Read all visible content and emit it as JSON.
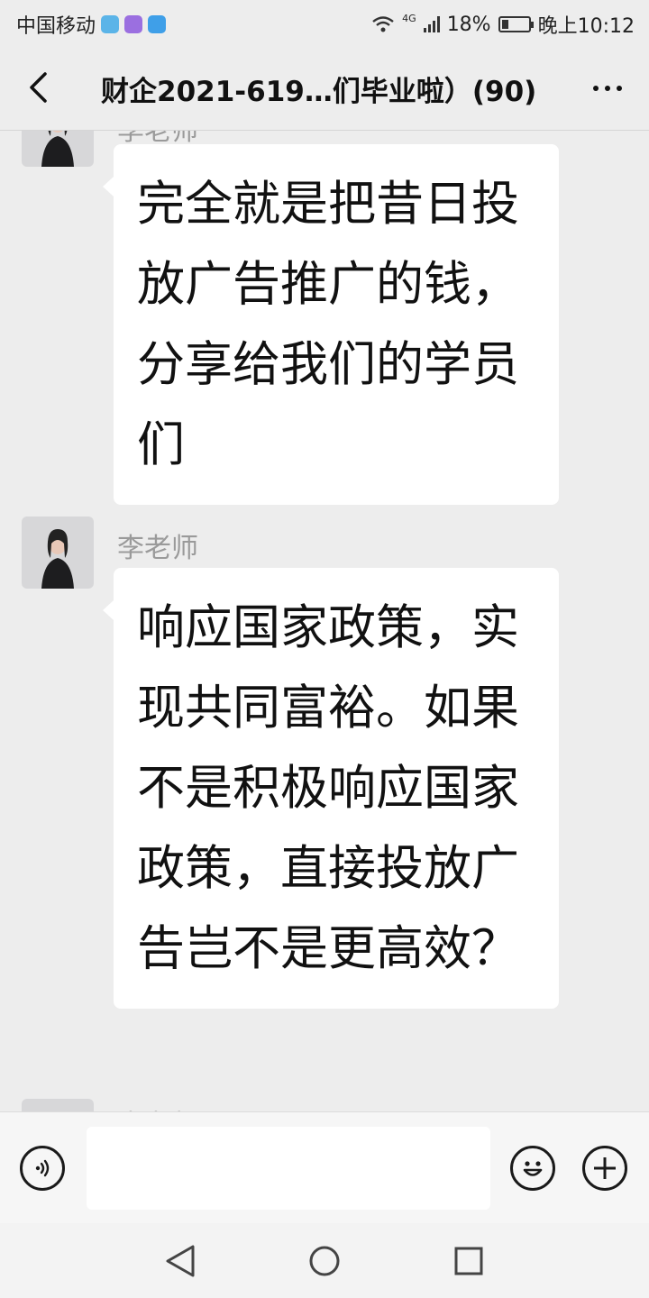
{
  "status_bar": {
    "carrier": "中国移动",
    "network": "4G",
    "battery": "18%",
    "time": "晚上10:12"
  },
  "header": {
    "title": "财企2021-619…们毕业啦）(90)"
  },
  "messages": [
    {
      "sender": "李老师",
      "text": "完全就是把昔日投放广告推广的钱，分享给我们的学员们"
    },
    {
      "sender": "李老师",
      "text": "响应国家政策，实现共同富裕。如果不是积极响应国家政策，直接投放广告岂不是更高效？"
    },
    {
      "sender": "李老师"
    }
  ],
  "input": {
    "value": ""
  },
  "colors": {
    "background": "#ededed",
    "bubble": "#ffffff",
    "sender_name": "#9a9a9a",
    "input_bar": "#f6f6f6"
  },
  "icons": [
    "back-arrow-icon",
    "more-icon",
    "voice-icon",
    "emoji-icon",
    "plus-icon",
    "nav-back-icon",
    "nav-home-icon",
    "nav-recent-icon"
  ]
}
